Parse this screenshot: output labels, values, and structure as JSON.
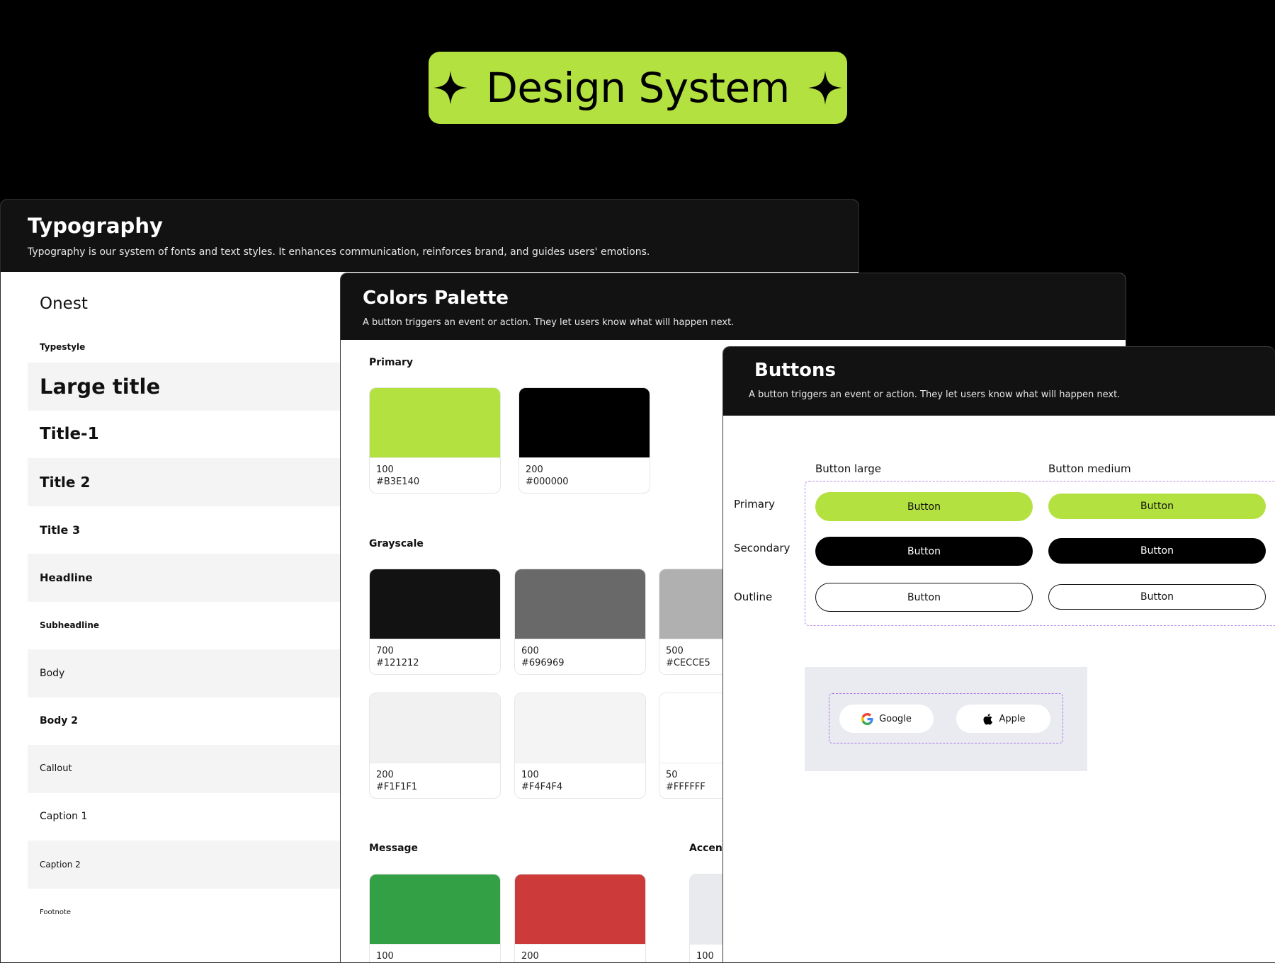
{
  "hero": {
    "title": "Design System"
  },
  "typography": {
    "title": "Typography",
    "description": "Typography is our system of fonts and text styles. It enhances communication, reinforces brand, and guides users' emotions.",
    "font_name": "Onest",
    "typestyle_label": "Typestyle",
    "styles": [
      "Large title",
      "Title-1",
      "Title 2",
      "Title 3",
      "Headline",
      "Subheadline",
      "Body",
      "Body 2",
      "Callout",
      "Caption 1",
      "Caption 2",
      "Footnote"
    ]
  },
  "colors": {
    "title": "Colors Palette",
    "description": "A button triggers an event or action. They let users know what will happen next.",
    "primary": {
      "label": "Primary",
      "swatches": [
        {
          "level": "100",
          "hex": "#B3E140"
        },
        {
          "level": "200",
          "hex": "#000000"
        }
      ]
    },
    "grayscale": {
      "label": "Grayscale",
      "swatches": [
        {
          "level": "700",
          "hex": "#121212"
        },
        {
          "level": "600",
          "hex": "#696969"
        },
        {
          "level": "500",
          "hex": "#CECCE5"
        },
        {
          "level": "200",
          "hex": "#F1F1F1"
        },
        {
          "level": "100",
          "hex": "#F4F4F4"
        },
        {
          "level": "50",
          "hex": "#FFFFFF"
        }
      ]
    },
    "message": {
      "label": "Message",
      "swatches": [
        {
          "level": "100",
          "color": "#34A045"
        },
        {
          "level": "200",
          "color": "#CC3A3A"
        }
      ]
    },
    "accent": {
      "label": "Accent",
      "swatches": [
        {
          "level": "100",
          "color": "#E8EAEE"
        }
      ]
    },
    "grayscale_display_colors": [
      "#121212",
      "#696969",
      "#B0B0B0",
      "#F1F1F1",
      "#F4F4F4",
      "#FFFFFF"
    ]
  },
  "buttons": {
    "title": "Buttons",
    "description": "A button triggers an event or action. They let users know what will happen next.",
    "columns": [
      "Button large",
      "Button medium"
    ],
    "rows": [
      "Primary",
      "Secondary",
      "Outline"
    ],
    "button_label": "Button",
    "social": {
      "google": "Google",
      "apple": "Apple"
    }
  },
  "accent_color": "#B3E140"
}
